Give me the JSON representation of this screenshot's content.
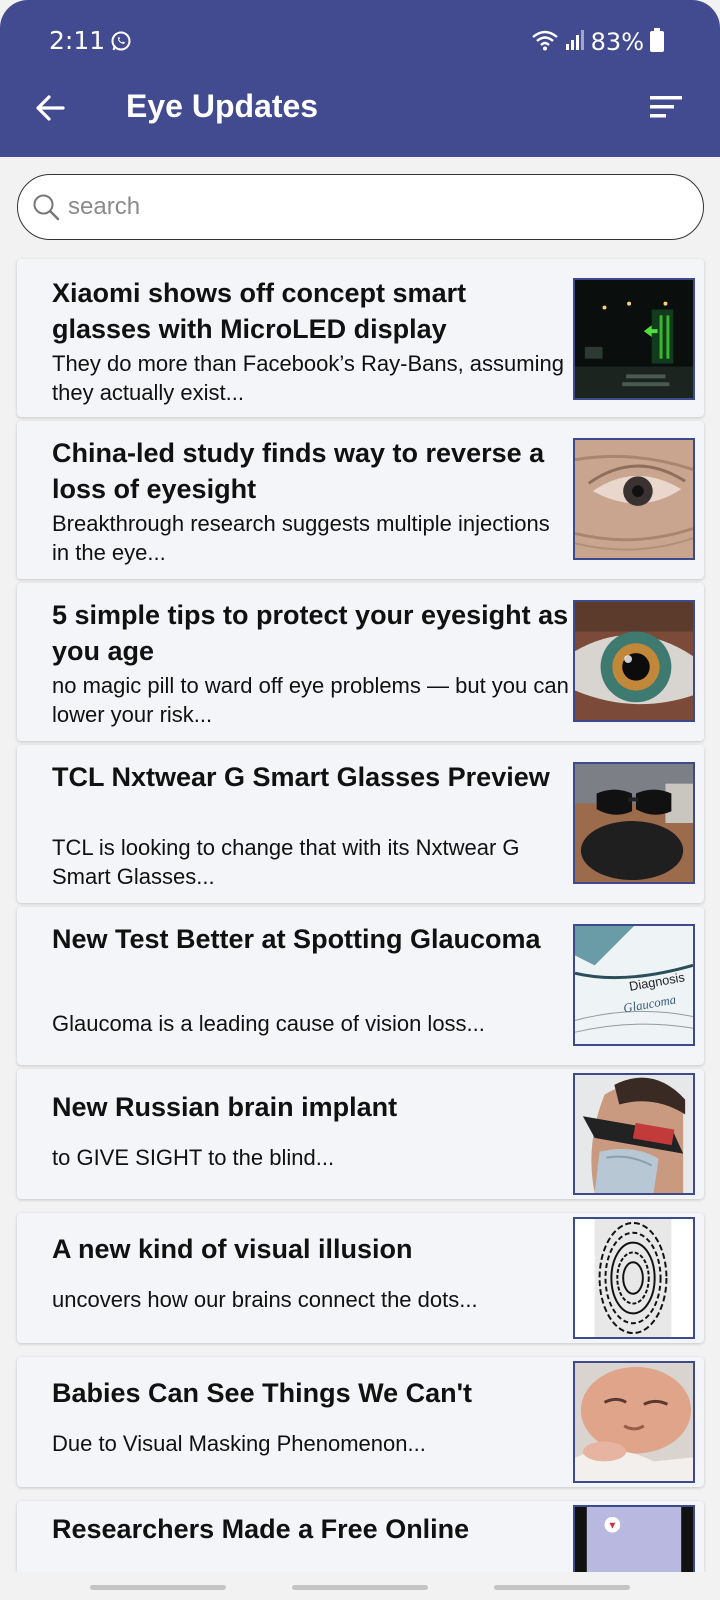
{
  "status_bar": {
    "time": "2:11",
    "battery": "83%"
  },
  "toolbar": {
    "title": "Eye Updates"
  },
  "search": {
    "placeholder": "search"
  },
  "articles": [
    {
      "title": "Xiaomi shows off concept smart glasses with MicroLED display",
      "desc": "They do more than Facebook’s Ray-Bans, assuming they actually exist..."
    },
    {
      "title": "China-led study finds way to reverse a loss of eyesight",
      "desc": "Breakthrough research suggests multiple injections in the eye..."
    },
    {
      "title": "5 simple tips to protect your eyesight as you age",
      "desc": "no magic pill to ward off eye problems — but you can lower your risk..."
    },
    {
      "title": "TCL Nxtwear G Smart Glasses Preview",
      "desc": "TCL is looking to change that with its Nxtwear G Smart Glasses..."
    },
    {
      "title": "New Test Better at Spotting Glaucoma",
      "desc": "Glaucoma is a leading cause of vision loss..."
    },
    {
      "title": "New Russian brain implant",
      "desc": "to GIVE SIGHT to the blind..."
    },
    {
      "title": "A new kind of visual illusion",
      "desc": "uncovers how our brains connect the dots..."
    },
    {
      "title": "Babies Can See Things We Can't",
      "desc": "Due to Visual Masking Phenomenon..."
    },
    {
      "title": "Researchers Made a Free Online",
      "desc": ""
    }
  ],
  "thumb_text": {
    "diagnosis": "Diagnosis",
    "glaucoma": "Glaucoma"
  },
  "colors": {
    "appbar": "#434b90",
    "thumb_border": "#3d4a8c",
    "card_bg": "#f3f5f8"
  }
}
